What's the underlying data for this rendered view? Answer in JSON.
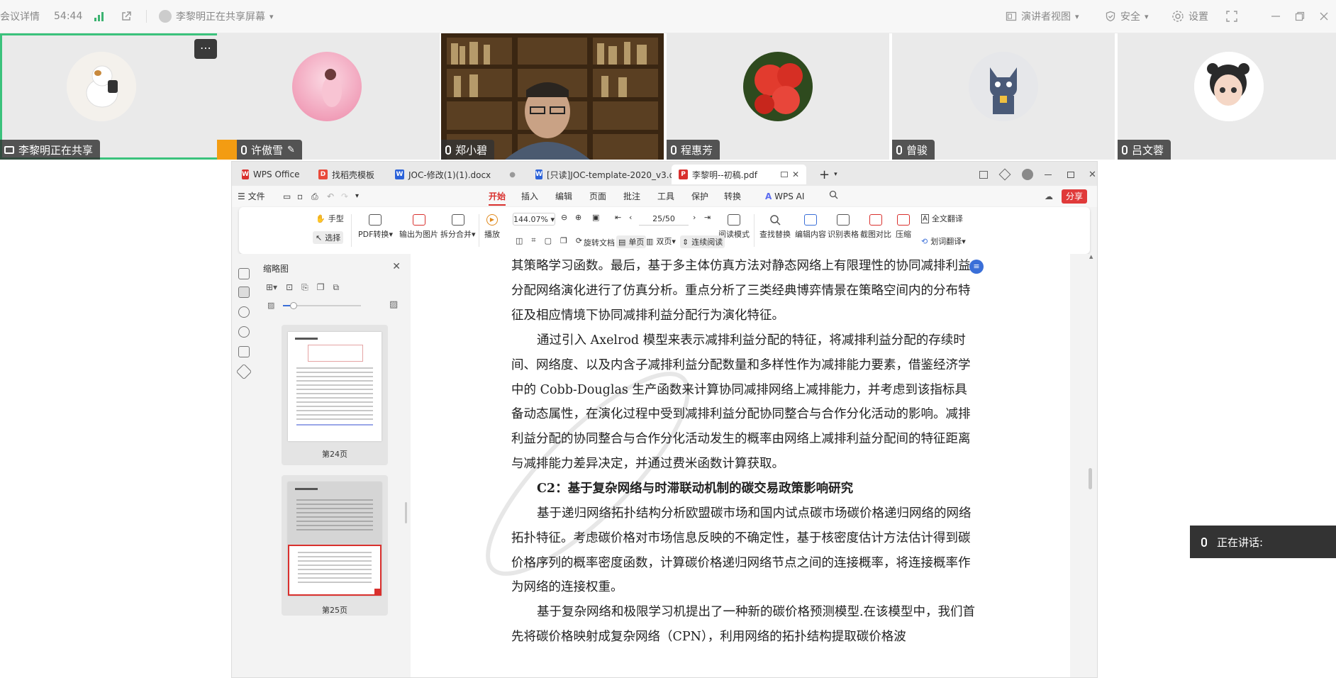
{
  "meeting": {
    "details_label": "会议详情",
    "timer": "54:44",
    "sharing_text": "李黎明正在共享屏幕",
    "presenter_view_label": "演讲者视图",
    "security_label": "安全",
    "settings_label": "设置",
    "signal_color": "#3cb371"
  },
  "participants": [
    {
      "name": "李黎明正在共享",
      "active": true
    },
    {
      "name": "许傲雪",
      "host": true
    },
    {
      "name": "郑小碧",
      "video": true
    },
    {
      "name": "程惠芳"
    },
    {
      "name": "曾骏"
    },
    {
      "name": "吕文蓉"
    }
  ],
  "wps": {
    "tabs": [
      {
        "label": "WPS Office",
        "icon": "wps-icon",
        "color": "#d9302d"
      },
      {
        "label": "找稻壳模板",
        "icon": "template-icon",
        "color": "#e94a3a"
      },
      {
        "label": "JOC-修改(1)(1).docx",
        "icon": "word-icon",
        "color": "#2b62d9"
      },
      {
        "label": "[只读]JOC-template-2020_v3.docx",
        "icon": "word-icon",
        "color": "#2b62d9"
      },
      {
        "label": "李黎明--初稿.pdf",
        "icon": "pdf-icon",
        "color": "#d9302d"
      }
    ],
    "menu": {
      "file_label": "文件",
      "items": [
        "开始",
        "插入",
        "编辑",
        "页面",
        "批注",
        "工具",
        "保护",
        "转换"
      ],
      "ai_label": "WPS AI",
      "share_label": "分享"
    },
    "ribbon": {
      "hand_label": "手型",
      "select_label": "选择",
      "pdf_convert": "PDF转换",
      "export_image": "输出为图片",
      "split_merge": "拆分合并",
      "play": "播放",
      "zoom_value": "144.07%",
      "page_value": "25/50",
      "rotate_doc": "旋转文档",
      "single_page": "单页",
      "double_page": "双页",
      "continuous": "连续阅读",
      "reading_mode": "阅读模式",
      "find_replace": "查找替换",
      "edit_content": "编辑内容",
      "ocr_table": "识别表格",
      "screenshot_compare": "截图对比",
      "compress": "压缩",
      "full_translate": "全文翻译",
      "word_translate": "划词翻译"
    },
    "thumbnails": {
      "title": "缩略图",
      "pages": [
        "第24页",
        "第25页"
      ]
    },
    "document": {
      "paragraphs": [
        {
          "text": "其策略学习函数。最后，基于多主体仿真方法对静态网络上有限理性的协同减排利益分配网络演化进行了仿真分析。重点分析了三类经典博弈情景在策略空间内的分布特征及相应情境下协同减排利益分配行为演化特征。",
          "kind": "cont"
        },
        {
          "text": "通过引入 Axelrod 模型来表示减排利益分配的特征，将减排利益分配的存续时间、网络度、以及内含子减排利益分配数量和多样性作为减排能力要素，借鉴经济学中的 Cobb-Douglas 生产函数来计算协同减排网络上减排能力，并考虑到该指标具备动态属性，在演化过程中受到减排利益分配协同整合与合作分化活动的影响。减排利益分配的协同整合与合作分化活动发生的概率由网络上减排利益分配间的特征距离与减排能力差异决定，并通过费米函数计算获取。",
          "kind": "indent"
        },
        {
          "text": "C2：基于复杂网络与时滞联动机制的碳交易政策影响研究",
          "kind": "heading"
        },
        {
          "text": "基于递归网络拓扑结构分析欧盟碳市场和国内试点碳市场碳价格递归网络的网络拓扑特征。考虑碳价格对市场信息反映的不确定性，基于核密度估计方法估计得到碳价格序列的概率密度函数，计算碳价格递归网络节点之间的连接概率，将连接概率作为网络的连接权重。",
          "kind": "indent"
        },
        {
          "text": "基于复杂网络和极限学习机提出了一种新的碳价格预测模型.在该模型中，我们首先将碳价格映射成复杂网络（CPN），利用网络的拓扑结构提取碳价格波",
          "kind": "indent"
        }
      ]
    }
  },
  "speaking": {
    "label": "正在讲话:"
  }
}
